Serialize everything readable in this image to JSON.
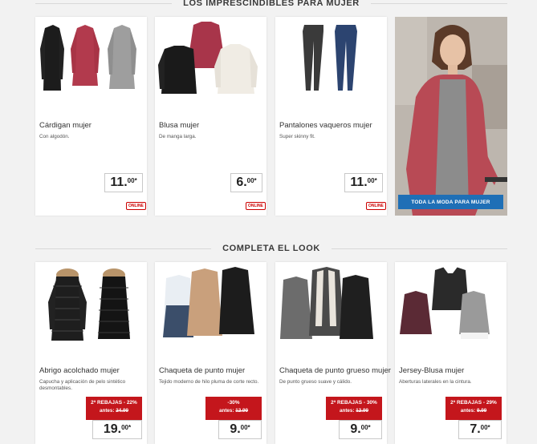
{
  "sections": {
    "top_title": "LOS IMPRESCINDIBLES PARA MUJER",
    "complete_title": "COMPLETA EL LOOK"
  },
  "top_products": [
    {
      "name": "Cárdigan mujer",
      "desc": "Con algodón.",
      "price": "11.",
      "cents": "00*",
      "badge": "ONLINE"
    },
    {
      "name": "Blusa mujer",
      "desc": "De manga larga.",
      "price": "6.",
      "cents": "00*",
      "badge": "ONLINE"
    },
    {
      "name": "Pantalones vaqueros mujer",
      "desc": "Super skinny fit.",
      "price": "11.",
      "cents": "00*",
      "badge": "ONLINE"
    }
  ],
  "promo": {
    "button_label": "TODA LA MODA PARA MUJER"
  },
  "look_products": [
    {
      "name": "Abrigo acolchado mujer",
      "desc": "Capucha y aplicación de pelo sintético desmontables.",
      "sale_line1": "2ª REBAJAS - 22%",
      "sale_prefix": "antes: ",
      "sale_old": "24.99",
      "price": "19.",
      "cents": "00*"
    },
    {
      "name": "Chaqueta de punto mujer",
      "desc": "Tejido moderno de hilo pluma de corte recto.",
      "sale_line1": "-30%",
      "sale_prefix": "antes: ",
      "sale_old": "12.99",
      "price": "9.",
      "cents": "00*"
    },
    {
      "name": "Chaqueta de punto grueso mujer",
      "desc": "De punto grueso suave y cálido.",
      "sale_line1": "2ª REBAJAS - 30%",
      "sale_prefix": "antes: ",
      "sale_old": "12.99",
      "price": "9.",
      "cents": "00*"
    },
    {
      "name": "Jersey-Blusa mujer",
      "desc": "Aberturas laterales en la cintura.",
      "sale_line1": "2ª REBAJAS - 29%",
      "sale_prefix": "antes: ",
      "sale_old": "9.99",
      "price": "7.",
      "cents": "00*"
    }
  ],
  "colors": {
    "sale_red": "#c4161c",
    "button_blue": "#1f6fb6",
    "background": "#f2f2f2"
  }
}
